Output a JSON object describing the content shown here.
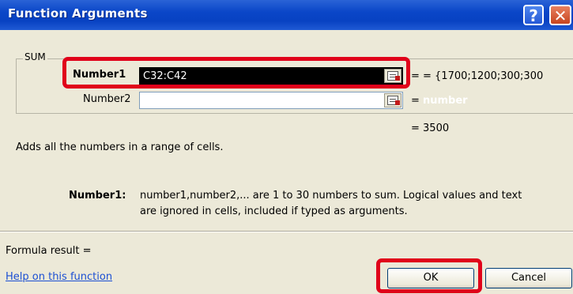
{
  "window": {
    "title": "Function Arguments",
    "help_glyph": "?",
    "close_glyph": "✕"
  },
  "function_group": {
    "label": "SUM"
  },
  "arguments": [
    {
      "label": "Number1",
      "value": "C32:C42",
      "result": "= {1700;1200;300;300"
    },
    {
      "label": "Number2",
      "value": "",
      "result": "number"
    }
  ],
  "equals_sign": "=",
  "function_result": "= 3500",
  "description": "Adds all the numbers in a range of cells.",
  "argument_help": {
    "name": "Number1:",
    "line1": "number1,number2,... are 1 to 30 numbers to sum. Logical values and text",
    "line2": "are ignored in cells, included if typed as arguments."
  },
  "formula_result_label": "Formula result =",
  "help_link": "Help on this function",
  "buttons": {
    "ok": "OK",
    "cancel": "Cancel"
  },
  "colors": {
    "titlebar": "#0842c2",
    "highlight": "#e0001a",
    "link": "#1b4fd3"
  }
}
